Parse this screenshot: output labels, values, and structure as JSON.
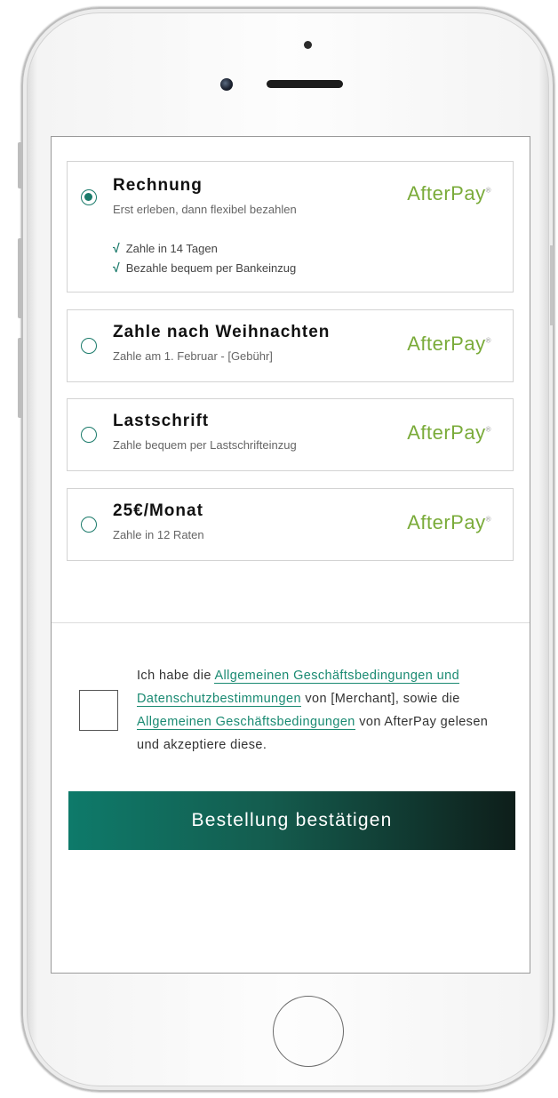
{
  "payment_options": [
    {
      "title": "Rechnung",
      "subtitle": "Erst erleben, dann flexibel bezahlen",
      "selected": true,
      "features": [
        "Zahle in 14 Tagen",
        "Bezahle bequem per Bankeinzug"
      ],
      "logo": "AfterPay"
    },
    {
      "title": "Zahle nach Weihnachten",
      "subtitle": "Zahle am 1. Februar - [Gebühr]",
      "selected": false,
      "logo": "AfterPay"
    },
    {
      "title": "Lastschrift",
      "subtitle": "Zahle bequem per Lastschrifteinzug",
      "selected": false,
      "logo": "AfterPay"
    },
    {
      "title": "25€/Monat",
      "subtitle": "Zahle in 12 Raten",
      "selected": false,
      "logo": "AfterPay"
    }
  ],
  "terms": {
    "checked": false,
    "part1": "Ich habe die ",
    "link1": "Allgemeinen Geschäftsbedingungen und Datenschutzbestimmungen",
    "part2": " von [Merchant], sowie die ",
    "link2": "Allgemeinen Geschäftsbedingungen",
    "part3": " von AfterPay gelesen und akzeptiere diese."
  },
  "confirm_button_label": "Bestellung bestätigen",
  "colors": {
    "accent": "#1a7a6a",
    "afterpay_logo": "#7aab3a",
    "button_gradient_start": "#0e7a6a",
    "button_gradient_end": "#0e1e1a"
  }
}
